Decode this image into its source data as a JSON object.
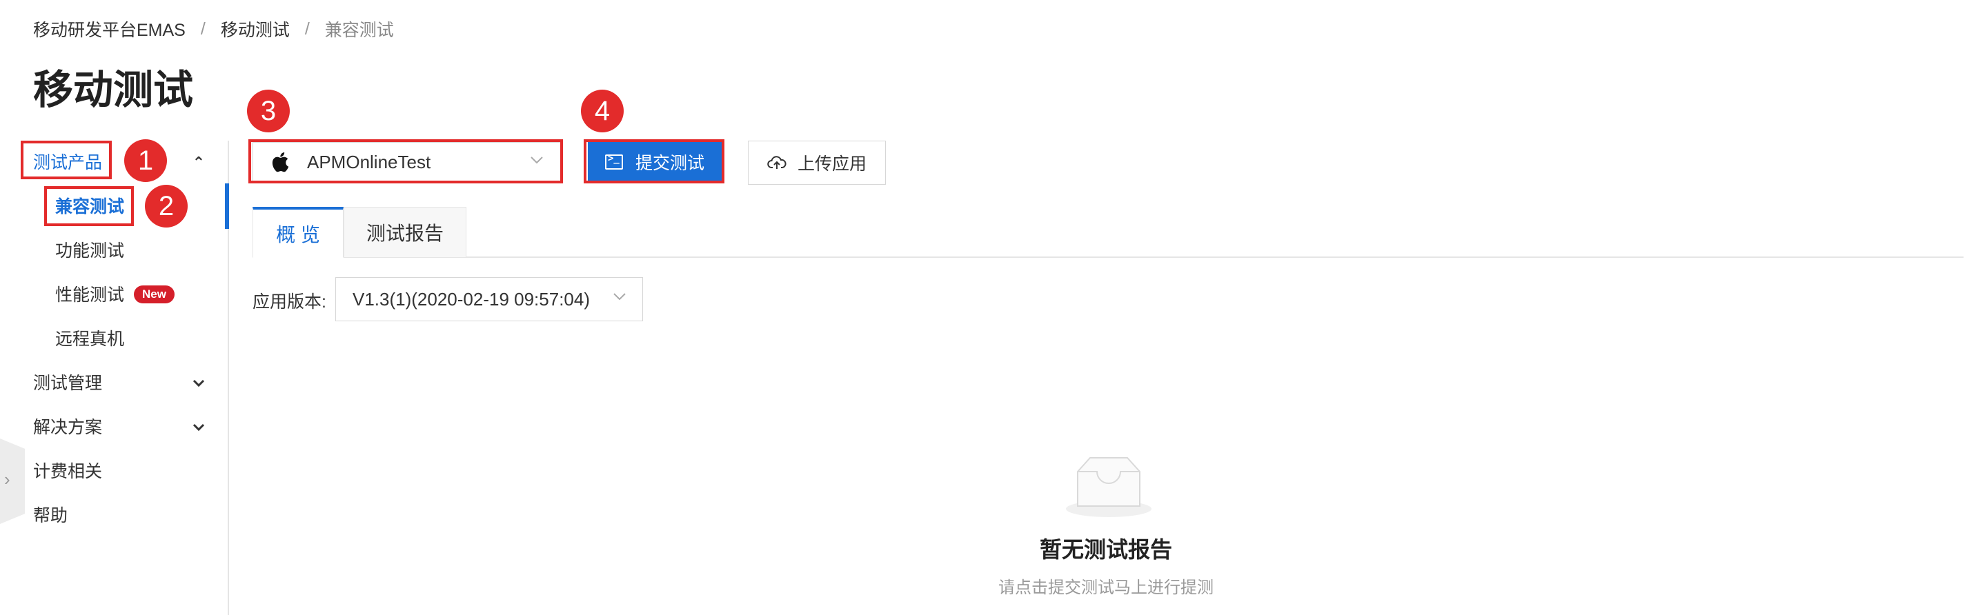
{
  "breadcrumb": {
    "items": [
      "移动研发平台EMAS",
      "移动测试",
      "兼容测试"
    ],
    "separator": "/"
  },
  "page_title": "移动测试",
  "sidebar": {
    "items": [
      {
        "label": "测试产品",
        "state": "expanded",
        "icon": "chevron-up-icon"
      },
      {
        "label": "兼容测试",
        "state": "selected"
      },
      {
        "label": "功能测试"
      },
      {
        "label": "性能测试",
        "badge": "New"
      },
      {
        "label": "远程真机"
      },
      {
        "label": "测试管理",
        "icon": "chevron-down-icon"
      },
      {
        "label": "解决方案",
        "icon": "chevron-down-icon"
      },
      {
        "label": "计费相关"
      },
      {
        "label": "帮助"
      }
    ],
    "collapse_icon": "chevron-right-icon"
  },
  "toolbar": {
    "app_select_value": "APMOnlineTest",
    "app_icon": "apple-icon",
    "submit_label": "提交测试",
    "upload_label": "上传应用"
  },
  "tabs": [
    {
      "label": "概 览",
      "active": true
    },
    {
      "label": "测试报告",
      "active": false
    }
  ],
  "version": {
    "label": "应用版本:",
    "value": "V1.3(1)(2020-02-19 09:57:04)"
  },
  "empty_state": {
    "title": "暂无测试报告",
    "subtitle": "请点击提交测试马上进行提测"
  },
  "annotations": [
    "1",
    "2",
    "3",
    "4"
  ],
  "colors": {
    "accent": "#1a6fd6",
    "annotation_red": "#e32b2b",
    "badge_red": "#d51f2a"
  }
}
